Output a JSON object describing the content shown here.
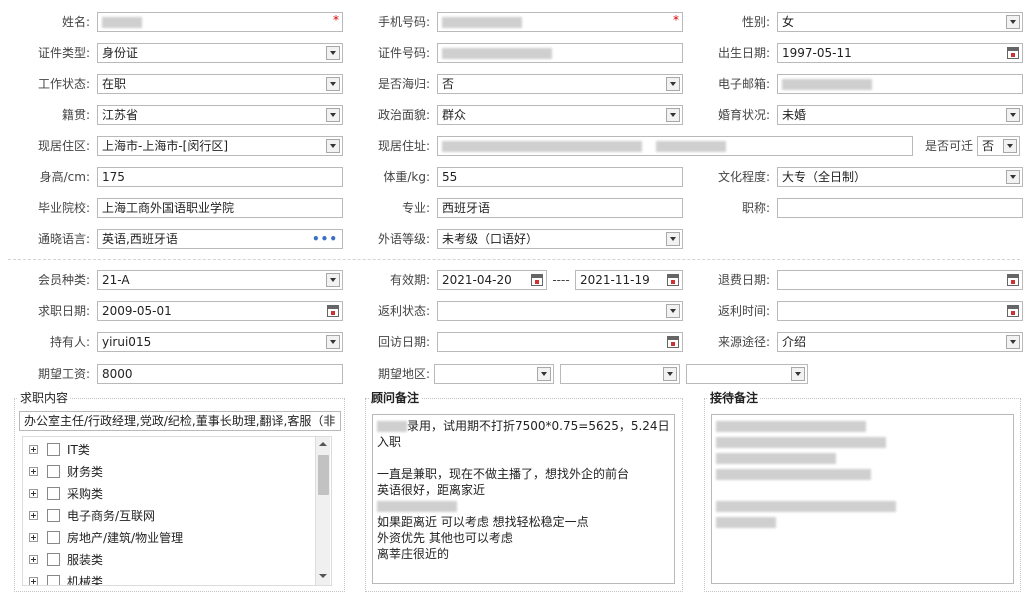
{
  "labels": {
    "name": "姓名:",
    "mobile": "手机号码:",
    "gender": "性别:",
    "id_type": "证件类型:",
    "id_number": "证件号码:",
    "birth_date": "出生日期:",
    "work_status": "工作状态:",
    "returnee": "是否海归:",
    "email": "电子邮箱:",
    "native_place": "籍贯:",
    "political": "政治面貌:",
    "marital": "婚育状况:",
    "residence_area": "现居住区:",
    "residence_address": "现居住址:",
    "relocate": "是否可迁",
    "height": "身高/cm:",
    "weight": "体重/kg:",
    "education": "文化程度:",
    "school": "毕业院校:",
    "major": "专业:",
    "title": "职称:",
    "languages": "通晓语言:",
    "foreign_level": "外语等级:",
    "member_type": "会员种类:",
    "valid_period": "有效期:",
    "refund_date": "退费日期:",
    "job_seek_date": "求职日期:",
    "rebate_status": "返利状态:",
    "rebate_time": "返利时间:",
    "holder": "持有人:",
    "visit_date": "回访日期:",
    "source": "来源途径:",
    "expected_salary": "期望工资:",
    "expected_area": "期望地区:",
    "period_sep": "----"
  },
  "values": {
    "gender": "女",
    "id_type": "身份证",
    "birth_date": "1997-05-11",
    "work_status": "在职",
    "returnee": "否",
    "native_place": "江苏省",
    "political": "群众",
    "marital": "未婚",
    "residence_area": "上海市-上海市-[闵行区]",
    "relocate": "否",
    "height": "175",
    "weight": "55",
    "education": "大专（全日制）",
    "school": "上海工商外国语职业学院",
    "major": "西班牙语",
    "title": "",
    "languages": "英语,西班牙语",
    "foreign_level": "未考级（口语好）",
    "member_type": "21-A",
    "valid_from": "2021-04-20",
    "valid_to": "2021-11-19",
    "refund_date": "",
    "job_seek_date": "2009-05-01",
    "rebate_status": "",
    "rebate_time": "",
    "holder": "yirui015",
    "visit_date": "",
    "source": "介绍",
    "expected_salary": "8000",
    "expected_area_1": "",
    "expected_area_2": "",
    "expected_area_3": ""
  },
  "panels": {
    "job_content_title": "求职内容",
    "job_content_selected": "办公室主任/行政经理,党政/纪检,董事长助理,翻译,客服（非",
    "categories": [
      "IT类",
      "财务类",
      "采购类",
      "电子商务/互联网",
      "房地产/建筑/物业管理",
      "服装类",
      "机械类"
    ],
    "advisor_title": "顾问备注",
    "advisor_note_line1": "录用，试用期不打折7500*0.75=5625，5.24日入职",
    "advisor_note_line2": "一直是兼职，现在不做主播了，想找外企的前台",
    "advisor_note_line3": "英语很好，距离家近",
    "advisor_note_line5": "如果距离近 可以考虑 想找轻松稳定一点",
    "advisor_note_line6": "外资优先 其他也可以考虑",
    "advisor_note_line7": "离莘庄很近的",
    "reception_title": "接待备注"
  },
  "icons": {
    "required_mark": "*",
    "ellipsis": "•••"
  }
}
